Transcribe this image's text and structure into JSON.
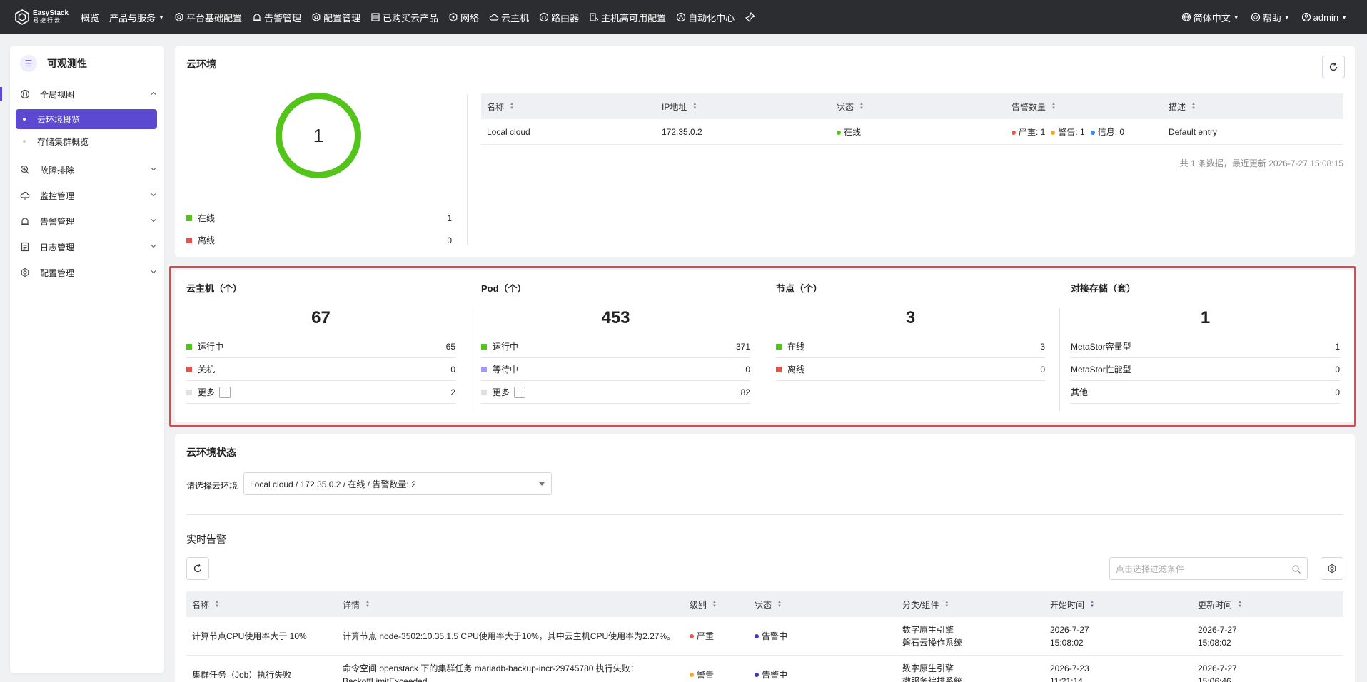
{
  "topbar": {
    "logo_line1": "EasyStack",
    "logo_line2": "易捷行云",
    "nav": [
      {
        "label": "概览",
        "icon": "",
        "caret": false
      },
      {
        "label": "产品与服务",
        "icon": "",
        "caret": true
      },
      {
        "label": "平台基础配置",
        "icon": "gear-icon",
        "caret": false
      },
      {
        "label": "告警管理",
        "icon": "alarm-icon",
        "caret": false
      },
      {
        "label": "配置管理",
        "icon": "gear-icon",
        "caret": false
      },
      {
        "label": "已购买云产品",
        "icon": "list-icon",
        "caret": false
      },
      {
        "label": "网络",
        "icon": "network-icon",
        "caret": false
      },
      {
        "label": "云主机",
        "icon": "cloud-icon",
        "caret": false
      },
      {
        "label": "路由器",
        "icon": "router-icon",
        "caret": false
      },
      {
        "label": "主机高可用配置",
        "icon": "host-icon",
        "caret": false
      },
      {
        "label": "自动化中心",
        "icon": "automation-icon",
        "caret": false
      }
    ],
    "language": "简体中文",
    "help": "帮助",
    "user": "admin"
  },
  "sidebar": {
    "title": "可观测性",
    "groups": [
      {
        "label": "全局视图",
        "icon": "globe-icon",
        "expanded": true
      },
      {
        "label": "故障排除",
        "icon": "troubleshoot-icon",
        "expanded": false
      },
      {
        "label": "监控管理",
        "icon": "monitor-icon",
        "expanded": false
      },
      {
        "label": "告警管理",
        "icon": "alarm-icon",
        "expanded": false
      },
      {
        "label": "日志管理",
        "icon": "log-icon",
        "expanded": false
      },
      {
        "label": "配置管理",
        "icon": "gear-icon",
        "expanded": false
      }
    ],
    "sub_items": [
      {
        "label": "云环境概览",
        "active": true
      },
      {
        "label": "存储集群概览",
        "active": false
      }
    ]
  },
  "env": {
    "title": "云环境",
    "donut_value": "1",
    "legend": [
      {
        "label": "在线",
        "value": "1",
        "color": "#52c41a"
      },
      {
        "label": "离线",
        "value": "0",
        "color": "#e5534b"
      }
    ],
    "table": {
      "headers": [
        "名称",
        "IP地址",
        "状态",
        "告警数量",
        "描述"
      ],
      "rows": [
        {
          "name": "Local cloud",
          "ip": "172.35.0.2",
          "status": "在线",
          "alerts": [
            {
              "label": "严重: 1",
              "color": "#e5534b"
            },
            {
              "label": "警告: 1",
              "color": "#f5a623"
            },
            {
              "label": "信息: 0",
              "color": "#2f8df4"
            }
          ],
          "desc": "Default entry"
        }
      ]
    },
    "footer": "共 1 条数据，最近更新  2026-7-27 15:08:15"
  },
  "stats": [
    {
      "title": "云主机（个）",
      "total": "67",
      "rows": [
        {
          "label": "运行中",
          "value": "65",
          "color": "#52c41a",
          "more": false
        },
        {
          "label": "关机",
          "value": "0",
          "color": "#e5534b",
          "more": false
        },
        {
          "label": "更多",
          "value": "2",
          "color": "#e0e0e0",
          "more": true
        }
      ]
    },
    {
      "title": "Pod（个）",
      "total": "453",
      "rows": [
        {
          "label": "运行中",
          "value": "371",
          "color": "#52c41a",
          "more": false
        },
        {
          "label": "等待中",
          "value": "0",
          "color": "#a29bfe",
          "more": false
        },
        {
          "label": "更多",
          "value": "82",
          "color": "#e0e0e0",
          "more": true
        }
      ]
    },
    {
      "title": "节点（个）",
      "total": "3",
      "rows": [
        {
          "label": "在线",
          "value": "3",
          "color": "#52c41a",
          "more": false
        },
        {
          "label": "离线",
          "value": "0",
          "color": "#e5534b",
          "more": false
        }
      ]
    },
    {
      "title": "对接存储（套）",
      "total": "1",
      "rows": [
        {
          "label": "MetaStor容量型",
          "value": "1",
          "color": "",
          "more": false
        },
        {
          "label": "MetaStor性能型",
          "value": "0",
          "color": "",
          "more": false
        },
        {
          "label": "其他",
          "value": "0",
          "color": "",
          "more": false
        }
      ]
    }
  ],
  "more_glyph": "···",
  "status": {
    "title": "云环境状态",
    "select_label": "请选择云环境",
    "select_value": "Local cloud / 172.35.0.2 / 在线 / 告警数量: 2",
    "alerts_title": "实时告警",
    "search_placeholder": "点击选择过滤条件",
    "headers": [
      "名称",
      "详情",
      "级别",
      "状态",
      "分类/组件",
      "开始时间",
      "更新时间"
    ],
    "rows": [
      {
        "name": "计算节点CPU使用率大于 10%",
        "detail": "计算节点 node-3502:10.35.1.5 CPU使用率大于10%，其中云主机CPU使用率为2.27%。",
        "level": "严重",
        "level_color": "#e5534b",
        "state": "告警中",
        "state_color": "#3b3ac4",
        "category1": "数字原生引擎",
        "category2": "磐石云操作系统",
        "start_date": "2026-7-27",
        "start_time": "15:08:02",
        "update_date": "2026-7-27",
        "update_time": "15:08:02"
      },
      {
        "name": "集群任务（Job）执行失败",
        "detail": "命令空间 openstack 下的集群任务 mariadb-backup-incr-29745780 执行失败：BackoffLimitExceeded",
        "level": "警告",
        "level_color": "#f5a623",
        "state": "告警中",
        "state_color": "#3b3ac4",
        "category1": "数字原生引擎",
        "category2": "微服务编排系统",
        "start_date": "2026-7-23",
        "start_time": "11:21:14",
        "update_date": "2026-7-27",
        "update_time": "15:06:46"
      }
    ]
  }
}
